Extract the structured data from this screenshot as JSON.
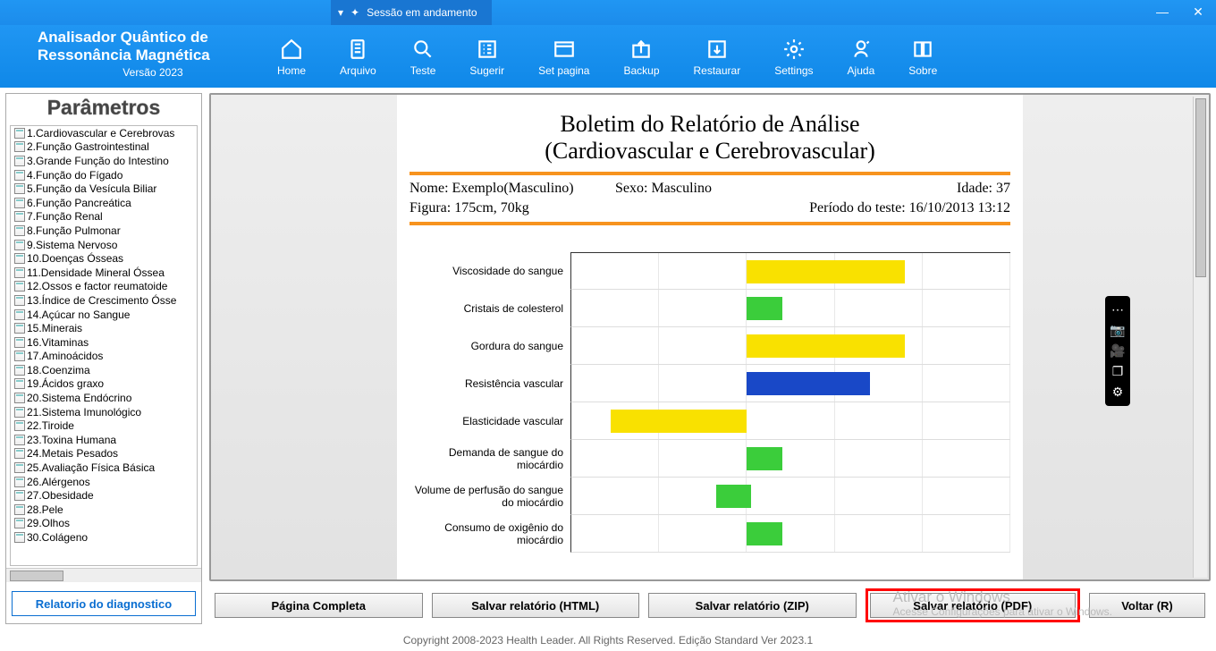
{
  "window": {
    "session": "Sessão em andamento"
  },
  "brand": {
    "title1": "Analisador Quântico de",
    "title2": "Ressonância Magnética",
    "version": "Versão 2023"
  },
  "tools": [
    "Home",
    "Arquivo",
    "Teste",
    "Sugerir",
    "Set pagina",
    "Backup",
    "Restaurar",
    "Settings",
    "Ajuda",
    "Sobre"
  ],
  "sidebar": {
    "title": "Parâmetros",
    "diag_btn": "Relatorio do diagnostico",
    "items": [
      {
        "n": "1",
        "label": "Cardiovascular e Cerebrovas"
      },
      {
        "n": "2",
        "label": "Função Gastrointestinal"
      },
      {
        "n": "3",
        "label": "Grande Função do Intestino"
      },
      {
        "n": "4",
        "label": "Função do Fígado"
      },
      {
        "n": "5",
        "label": "Função da Vesícula Biliar"
      },
      {
        "n": "6",
        "label": "Função Pancreática"
      },
      {
        "n": "7",
        "label": "Função Renal"
      },
      {
        "n": "8",
        "label": "Função Pulmonar"
      },
      {
        "n": "9",
        "label": "Sistema Nervoso"
      },
      {
        "n": "10",
        "label": "Doenças Ósseas"
      },
      {
        "n": "11",
        "label": "Densidade Mineral Óssea"
      },
      {
        "n": "12",
        "label": "Ossos e factor reumatoide"
      },
      {
        "n": "13",
        "label": "Índice de Crescimento Ósse"
      },
      {
        "n": "14",
        "label": "Açúcar no Sangue"
      },
      {
        "n": "15",
        "label": "Minerais"
      },
      {
        "n": "16",
        "label": "Vitaminas"
      },
      {
        "n": "17",
        "label": "Aminoácidos"
      },
      {
        "n": "18",
        "label": "Coenzima"
      },
      {
        "n": "19",
        "label": "Ácidos graxo"
      },
      {
        "n": "20",
        "label": "Sistema Endócrino"
      },
      {
        "n": "21",
        "label": "Sistema Imunológico"
      },
      {
        "n": "22",
        "label": "Tiroide"
      },
      {
        "n": "23",
        "label": "Toxina Humana"
      },
      {
        "n": "24",
        "label": "Metais Pesados"
      },
      {
        "n": "25",
        "label": "Avaliação Física Básica"
      },
      {
        "n": "26",
        "label": "Alérgenos"
      },
      {
        "n": "27",
        "label": "Obesidade"
      },
      {
        "n": "28",
        "label": "Pele"
      },
      {
        "n": "29",
        "label": "Olhos"
      },
      {
        "n": "30",
        "label": "Colágeno"
      }
    ]
  },
  "report": {
    "title": "Boletim do Relatório de Análise",
    "subtitle": "(Cardiovascular e Cerebrovascular)",
    "info": {
      "name_label": "Nome:",
      "name_value": "Exemplo(Masculino)",
      "sex_label": "Sexo:",
      "sex_value": "Masculino",
      "age_label": "Idade:",
      "age_value": "37",
      "figure_label": "Figura:",
      "figure_value": "175cm, 70kg",
      "period_label": "Período do teste:",
      "period_value": "16/10/2013 13:12"
    }
  },
  "chart_data": {
    "type": "bar",
    "orientation": "horizontal",
    "xlim": [
      0,
      100
    ],
    "series": [
      {
        "label": "Viscosidade do sangue",
        "start": 40,
        "width": 36,
        "color": "#f9e100"
      },
      {
        "label": "Cristais de colesterol",
        "start": 40,
        "width": 8,
        "color": "#3bcd3b"
      },
      {
        "label": "Gordura do sangue",
        "start": 40,
        "width": 36,
        "color": "#f9e100"
      },
      {
        "label": "Resistência vascular",
        "start": 40,
        "width": 28,
        "color": "#1948c7"
      },
      {
        "label": "Elasticidade vascular",
        "start": 9,
        "width": 31,
        "color": "#f9e100"
      },
      {
        "label": "Demanda de sangue do miocárdio",
        "start": 40,
        "width": 8,
        "color": "#3bcd3b"
      },
      {
        "label": "Volume de perfusão do sangue do miocárdio",
        "start": 33,
        "width": 8,
        "color": "#3bcd3b"
      },
      {
        "label": "Consumo de oxigênio do miocárdio",
        "start": 40,
        "width": 8,
        "color": "#3bcd3b"
      }
    ]
  },
  "buttons": {
    "full": "Página Completa",
    "html": "Salvar relatório (HTML)",
    "zip": "Salvar relatório (ZIP)",
    "pdf": "Salvar relatório (PDF)",
    "back": "Voltar (R)"
  },
  "watermark": {
    "t": "Ativar o Windows",
    "s": "Acesse Configurações para ativar o Windows."
  },
  "footer": "Copyright 2008-2023 Health Leader. All Rights Reserved.  Edição Standard Ver 2023.1"
}
